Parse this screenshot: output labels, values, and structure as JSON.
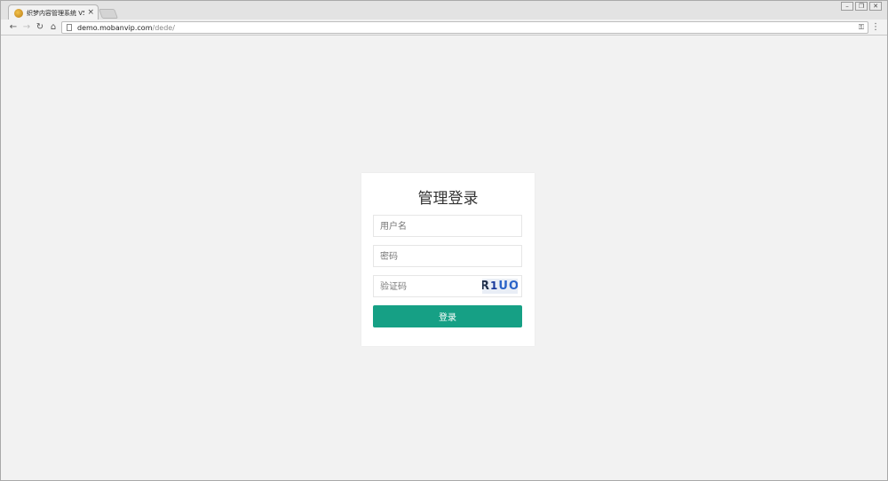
{
  "browser": {
    "tab_title": "织梦内容管理系统 V57_",
    "tab_close": "×",
    "url_host": "demo.mobanvip.com",
    "url_path": "/dede/",
    "icons": {
      "back": "arrow-left-icon",
      "forward": "arrow-right-icon",
      "reload": "reload-icon",
      "home": "home-icon",
      "key": "key-icon",
      "menu": "more-vertical-icon"
    }
  },
  "login": {
    "title": "管理登录",
    "username_placeholder": "用户名",
    "password_placeholder": "密码",
    "captcha_placeholder": "验证码",
    "captcha_chars": [
      "R",
      "1",
      "U",
      "O"
    ],
    "button_label": "登录",
    "button_color": "#16a085"
  },
  "colors": {
    "page_background": "#f2f2f2",
    "card_background": "#ffffff",
    "accent": "#16a085"
  }
}
